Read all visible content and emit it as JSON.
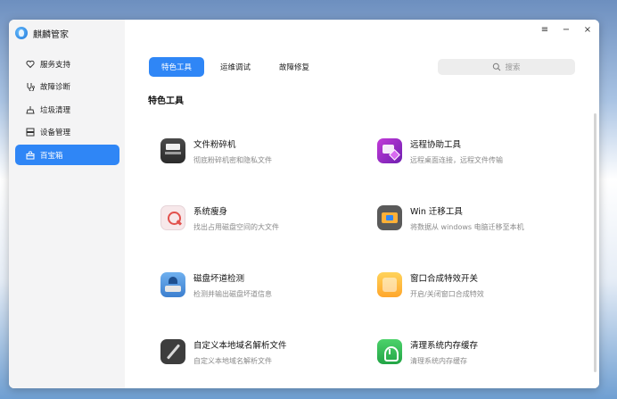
{
  "app": {
    "name": "麒麟管家"
  },
  "window_controls": {
    "menu": "≡",
    "minimize": "−",
    "close": "×"
  },
  "sidebar": {
    "items": [
      {
        "label": "服务支持",
        "icon": "heart-icon",
        "active": false
      },
      {
        "label": "故障诊断",
        "icon": "diagnosis-icon",
        "active": false
      },
      {
        "label": "垃圾清理",
        "icon": "broom-icon",
        "active": false
      },
      {
        "label": "设备管理",
        "icon": "device-icon",
        "active": false
      },
      {
        "label": "百宝箱",
        "icon": "toolbox-icon",
        "active": true
      }
    ]
  },
  "tabs": [
    {
      "label": "特色工具",
      "active": true
    },
    {
      "label": "运维调试",
      "active": false
    },
    {
      "label": "故障修复",
      "active": false
    }
  ],
  "search": {
    "placeholder": "搜索"
  },
  "section": {
    "title": "特色工具"
  },
  "tools": [
    {
      "name": "文件粉碎机",
      "desc": "彻底粉碎机密和隐私文件",
      "icon": "shredder-icon"
    },
    {
      "name": "远程协助工具",
      "desc": "远程桌面连接，远程文件传输",
      "icon": "remote-assist-icon"
    },
    {
      "name": "系统瘦身",
      "desc": "找出占用磁盘空间的大文件",
      "icon": "magnifier-icon"
    },
    {
      "name": "Win 迁移工具",
      "desc": "将数据从 windows 电脑迁移至本机",
      "icon": "migrate-icon"
    },
    {
      "name": "磁盘坏道检测",
      "desc": "检测并输出磁盘坏道信息",
      "icon": "disk-check-icon"
    },
    {
      "name": "窗口合成特效开关",
      "desc": "开启/关闭窗口合成特效",
      "icon": "window-effect-icon"
    },
    {
      "name": "自定义本地域名解析文件",
      "desc": "自定义本地域名解析文件",
      "icon": "pen-icon"
    },
    {
      "name": "清理系统内存缓存",
      "desc": "清理系统内存缓存",
      "icon": "memory-clean-icon"
    }
  ],
  "colors": {
    "accent": "#2f86f6"
  }
}
